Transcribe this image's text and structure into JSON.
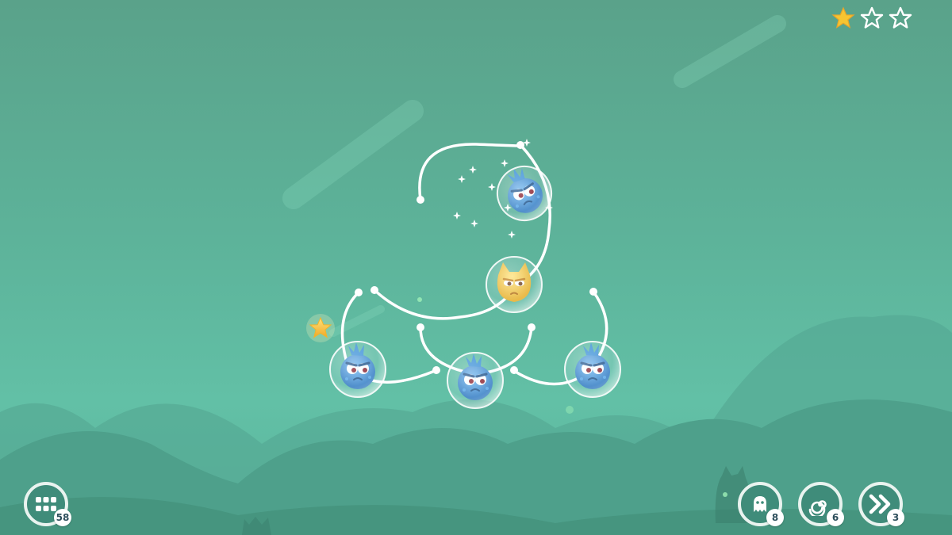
{
  "level_stars": {
    "earned": 1,
    "total": 3
  },
  "menu_button": {
    "icon": "level-grid-icon",
    "count": "58"
  },
  "powerups": [
    {
      "name": "ghost",
      "icon": "ghost-icon",
      "count": "8"
    },
    {
      "name": "spiral",
      "icon": "spiral-icon",
      "count": "6"
    },
    {
      "name": "skip",
      "icon": "fast-forward-icon",
      "count": "3"
    }
  ],
  "colors": {
    "background": "#5db39a",
    "hill_dark": "#4a9c86",
    "track": "#ffffff",
    "bubble": "#d9f1ff",
    "blue_creature": "#3b8fd6",
    "yellow_creature": "#f5c12c",
    "star_gold": "#f7c531"
  }
}
